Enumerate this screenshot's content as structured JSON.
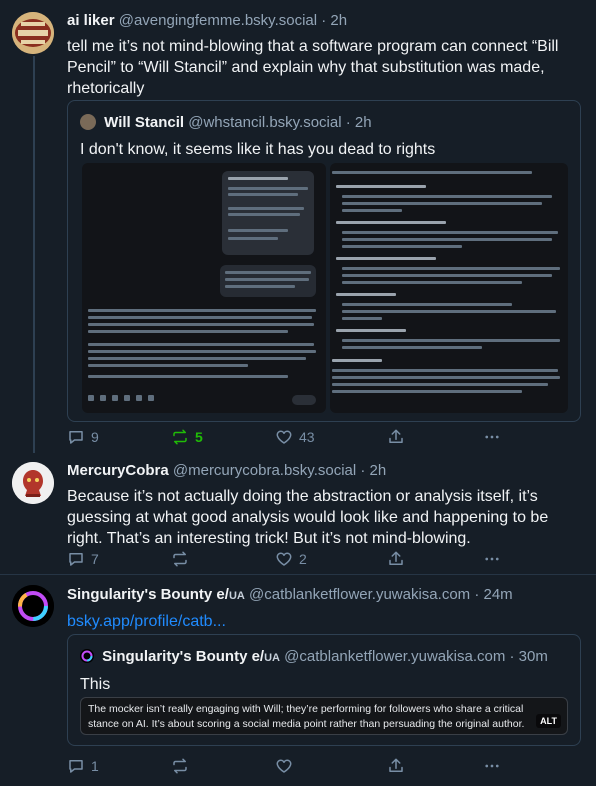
{
  "posts": [
    {
      "name": "ai liker",
      "handle": "@avengingfemme.bsky.social",
      "time": "· 2h",
      "text": "tell me it’s not mind-blowing that a software program can connect “Bill Pencil” to “Will Stancil” and explain why that substitution was made, rhetorically",
      "quote": {
        "name": "Will Stancil",
        "handle": "@whstancil.bsky.social",
        "time": "· 2h",
        "text": "I don't know, it seems like it has you dead to rights"
      },
      "actions": {
        "replies": "9",
        "reposts": "5",
        "likes": "43"
      }
    },
    {
      "name": "MercuryCobra",
      "handle": "@mercurycobra.bsky.social",
      "time": "· 2h",
      "text": "Because it’s not actually doing the abstraction or analysis itself, it’s guessing at what good analysis would look like and happening to be right. That’s an interesting trick! But it’s not mind-blowing.",
      "actions": {
        "replies": "7",
        "likes": "2"
      }
    },
    {
      "name": "Singularity's Bounty e/",
      "name_tag": "UA",
      "handle": "@catblanketflower.yuwakisa.com",
      "time": "· 24m",
      "link": "bsky.app/profile/catb...",
      "quote": {
        "name": "Singularity's Bounty e/",
        "name_tag": "UA",
        "handle": "@catblanketflower.yuwakisa.com",
        "time": "· 30m",
        "text": "This",
        "image_caption": "The mocker isn’t really engaging with Will; they’re performing for followers who share a critical stance on AI. It’s about scoring a social media point rather than persuading the original author.",
        "alt": "ALT"
      },
      "actions": {
        "replies": "1"
      }
    }
  ],
  "icons": {
    "reply": "reply-icon",
    "repost": "repost-icon",
    "like": "heart-icon",
    "share": "share-icon",
    "more": "more-icon"
  },
  "colors": {
    "background": "#161e27",
    "link": "#208bfe",
    "repost_active": "#20bc07",
    "muted": "#93a5b7"
  }
}
